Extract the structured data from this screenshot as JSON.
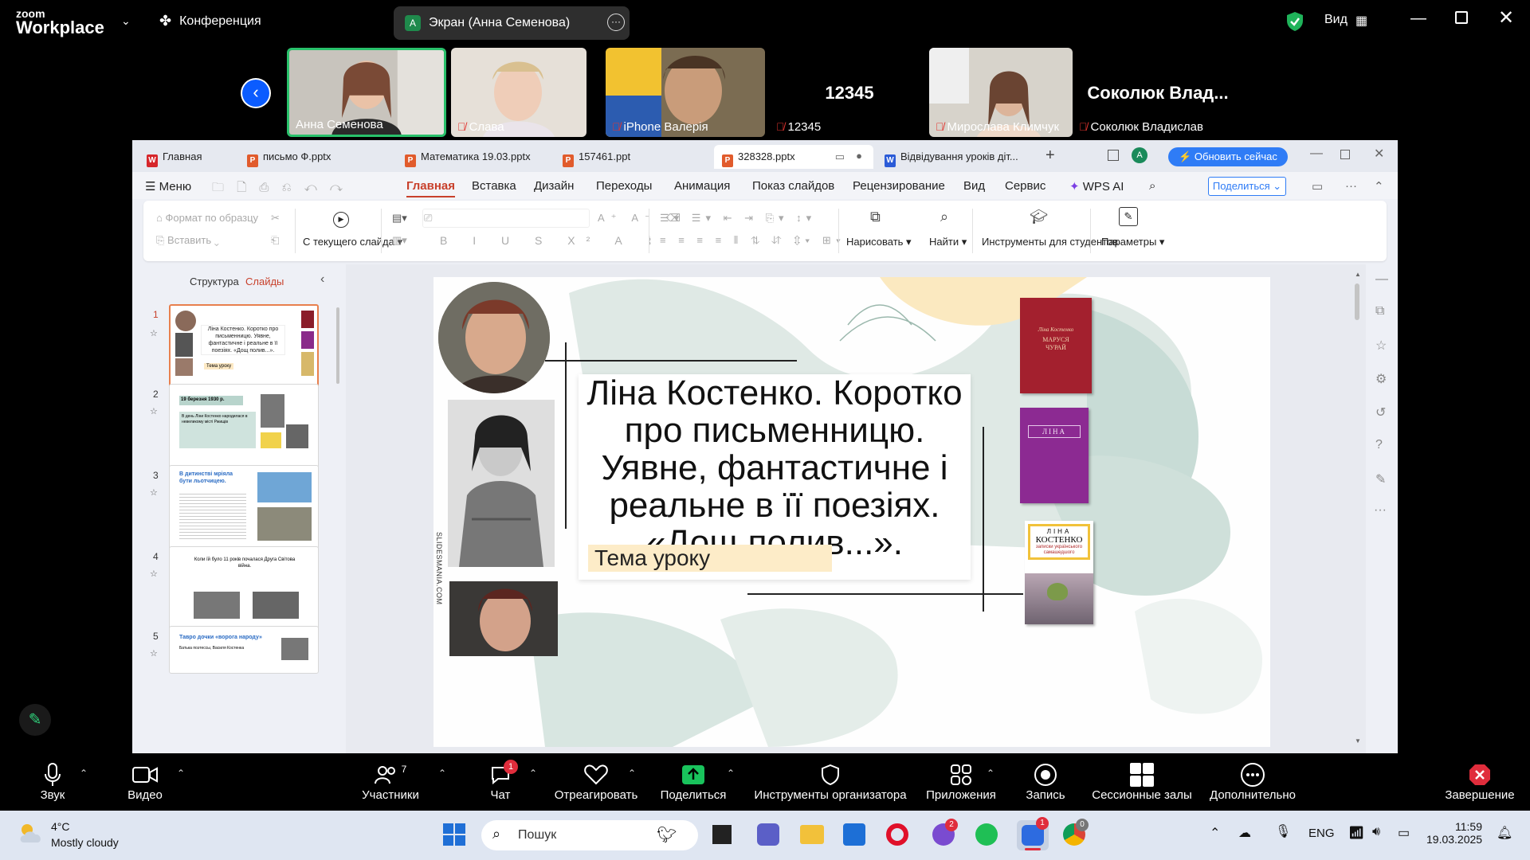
{
  "zoom": {
    "logo_line1": "zoom",
    "logo_line2": "Workplace",
    "meeting_label": "Конференция",
    "share_initial": "A",
    "share_title": "Экран (Анна Семенова)",
    "view_label": "Вид",
    "participants": [
      {
        "name": "Анна Семенова",
        "muted": false
      },
      {
        "name": "Слава",
        "muted": true
      },
      {
        "name": "iPhone Валерія",
        "muted": true
      },
      {
        "name": "12345",
        "muted": true,
        "big_label": "12345"
      },
      {
        "name": "Мирослава Климчук",
        "muted": true
      },
      {
        "name": "Соколюк Владислав",
        "muted": true,
        "big_label": "Соколюк Влад..."
      }
    ],
    "bottom": {
      "audio": "Звук",
      "video": "Видео",
      "participants": "Участники",
      "participants_count": "7",
      "chat": "Чат",
      "chat_badge": "1",
      "react": "Отреагировать",
      "share": "Поделиться",
      "host_tools": "Инструменты организатора",
      "apps": "Приложения",
      "record": "Запись",
      "breakout": "Сессионные залы",
      "more": "Дополнительно",
      "end": "Завершение"
    }
  },
  "wps": {
    "tabs": [
      {
        "label": "Главная",
        "icon": "W"
      },
      {
        "label": "письмо Ф.pptx",
        "icon": "P"
      },
      {
        "label": "Математика 19.03.pptx",
        "icon": "P"
      },
      {
        "label": "157461.ppt",
        "icon": "P"
      },
      {
        "label": "328328.pptx",
        "icon": "P"
      },
      {
        "label": "Відвідування уроків діт...",
        "icon": "W"
      }
    ],
    "user_initial": "A",
    "update_button": "Обновить сейчас",
    "menu": {
      "menu": "Меню",
      "home": "Главная",
      "insert": "Вставка",
      "design": "Дизайн",
      "transitions": "Переходы",
      "animation": "Анимация",
      "slideshow": "Показ слайдов",
      "review": "Рецензирование",
      "view": "Вид",
      "service": "Сервис",
      "ai": "WPS AI",
      "share": "Поделиться"
    },
    "ribbon": {
      "format_painter": "Формат по образцу",
      "paste": "Вставить",
      "from_current": "С текущего слайда",
      "draw": "Нарисовать",
      "find": "Найти",
      "student_tools": "Инструменты для студентов",
      "params": "Параметры"
    },
    "pane": {
      "outline": "Структура",
      "slides": "Слайды"
    },
    "thumbs": [
      {
        "num": "1",
        "text": "Ліна Костенко. Коротко про письменницю. Уявне, фантастичне і реальне в її поезіях. «Дощ полив...».",
        "sub": "Тема уроку"
      },
      {
        "num": "2",
        "text": "19 березня 1930 р.",
        "sub": "В день Ліни Костенко народилася в невеликому місті Ржищів"
      },
      {
        "num": "3",
        "text": "В дитинстві мріяла бути льотчицею.",
        "sub": ""
      },
      {
        "num": "4",
        "text": "Коли їй було 11 років почалася Друга Світова війна.",
        "sub": ""
      },
      {
        "num": "5",
        "text": "Тавро дочки «ворога народу»",
        "sub": "Батька поэтессы, Василя Костенка"
      }
    ],
    "slide": {
      "title": "Ліна Костенко. Коротко про письменницю. Уявне, фантастичне і реальне в її поезіях. «Дощ полив...».",
      "subtitle": "Тема уроку",
      "watermark": "SLIDESMANIA.COM",
      "book1_line1": "Ліна Костенко",
      "book1_line2": "МАРУСЯ ЧУРАЙ",
      "book2": "ЛІНА",
      "book3_line1": "ЛІНА",
      "book3_line2": "КОСТЕНКО",
      "book3_line3": "записки українського самашедшого"
    }
  },
  "taskbar": {
    "temp": "4°C",
    "weather": "Mostly cloudy",
    "search": "Пошук",
    "lang": "ENG",
    "time": "11:59",
    "date": "19.03.2025",
    "badge_viber": "2",
    "badge_zoom": "1",
    "badge_chrome": "0"
  }
}
